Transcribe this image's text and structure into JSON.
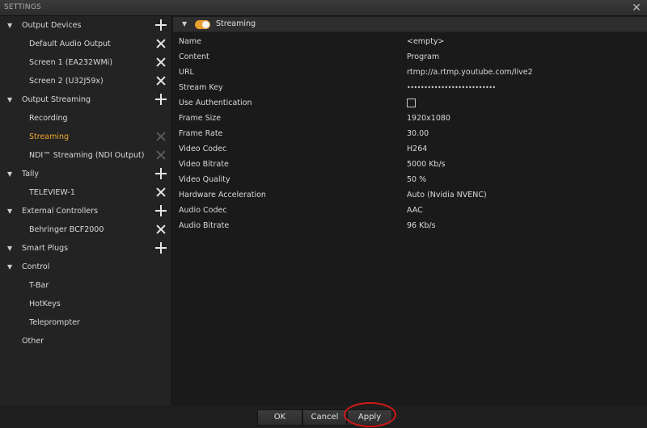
{
  "window": {
    "title": "SETTINGS",
    "close_glyph": "✕"
  },
  "sidebar": {
    "caret": "▼",
    "items": [
      {
        "label": "Output Devices",
        "kind": "category",
        "action": "add"
      },
      {
        "label": "Default Audio Output",
        "kind": "child",
        "action": "remove"
      },
      {
        "label": "Screen 1 (EA232WMi)",
        "kind": "child",
        "action": "remove"
      },
      {
        "label": "Screen 2 (U32J59x)",
        "kind": "child",
        "action": "remove"
      },
      {
        "label": "Output Streaming",
        "kind": "category",
        "action": "add"
      },
      {
        "label": "Recording",
        "kind": "child",
        "action": "none"
      },
      {
        "label": "Streaming",
        "kind": "child",
        "action": "remove-disabled",
        "selected": true
      },
      {
        "label": "NDI™ Streaming (NDI Output)",
        "kind": "child",
        "action": "remove-disabled"
      },
      {
        "label": "Tally",
        "kind": "category",
        "action": "add"
      },
      {
        "label": "TELEVIEW-1",
        "kind": "child",
        "action": "remove"
      },
      {
        "label": "External Controllers",
        "kind": "category",
        "action": "add"
      },
      {
        "label": "Behringer BCF2000",
        "kind": "child",
        "action": "remove"
      },
      {
        "label": "Smart Plugs",
        "kind": "category",
        "action": "add"
      },
      {
        "label": "Control",
        "kind": "category",
        "action": "none"
      },
      {
        "label": "T-Bar",
        "kind": "child",
        "action": "none"
      },
      {
        "label": "HotKeys",
        "kind": "child",
        "action": "none"
      },
      {
        "label": "Teleprompter",
        "kind": "child",
        "action": "none"
      },
      {
        "label": "Other",
        "kind": "category-nocaret",
        "action": "none"
      }
    ]
  },
  "section": {
    "caret": "▼",
    "title": "Streaming",
    "toggle_on": true,
    "accent_color": "#e8a030"
  },
  "properties": [
    {
      "name": "Name",
      "value": "<empty>"
    },
    {
      "name": "Content",
      "value": "Program"
    },
    {
      "name": "URL",
      "value": "rtmp://a.rtmp.youtube.com/live2"
    },
    {
      "name": "Stream Key",
      "value": "••••••••••••••••••••••••••",
      "masked": true
    },
    {
      "name": "Use Authentication",
      "value": "",
      "checkbox": true,
      "checked": false
    },
    {
      "name": "Frame Size",
      "value": "1920x1080"
    },
    {
      "name": "Frame Rate",
      "value": "30.00"
    },
    {
      "name": "Video Codec",
      "value": "H264"
    },
    {
      "name": "Video Bitrate",
      "value": "5000 Kb/s"
    },
    {
      "name": "Video Quality",
      "value": "50 %"
    },
    {
      "name": "Hardware Acceleration",
      "value": "Auto (Nvidia NVENC)"
    },
    {
      "name": "Audio Codec",
      "value": "AAC"
    },
    {
      "name": "Audio Bitrate",
      "value": "96 Kb/s"
    }
  ],
  "footer": {
    "ok_label": "OK",
    "cancel_label": "Cancel",
    "apply_label": "Apply",
    "highlight_color": "#d01818"
  }
}
